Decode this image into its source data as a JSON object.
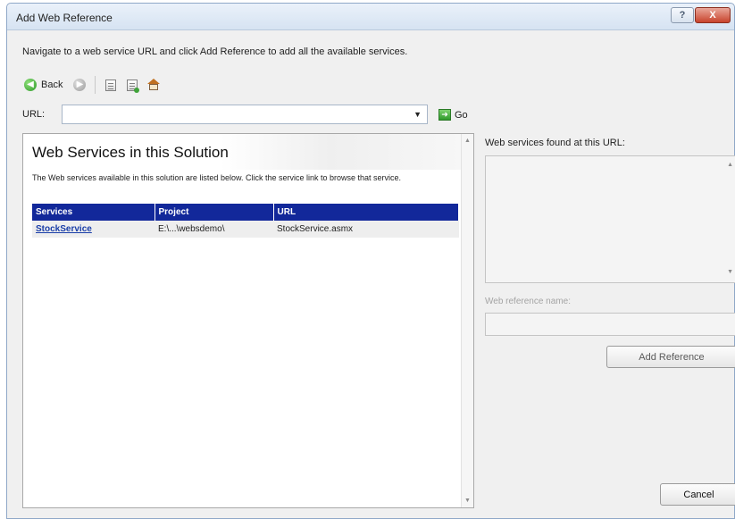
{
  "window": {
    "title": "Add Web Reference",
    "help_glyph": "?",
    "close_glyph": "X"
  },
  "instruction": "Navigate to a web service URL and click Add Reference to add all the available services.",
  "toolbar": {
    "back_label": "Back",
    "back_icon": "back-arrow-icon",
    "forward_icon": "forward-arrow-icon",
    "stop_icon": "stop-page-icon",
    "refresh_icon": "refresh-page-icon",
    "home_icon": "home-icon"
  },
  "url_bar": {
    "label": "URL:",
    "value": "",
    "dropdown_glyph": "▼",
    "go_label": "Go",
    "go_icon": "go-arrow-icon"
  },
  "browser": {
    "heading": "Web Services in this Solution",
    "description": "The Web services available in this solution are listed below. Click the service link to browse that service.",
    "table": {
      "columns": [
        "Services",
        "Project",
        "URL"
      ],
      "rows": [
        {
          "service": "StockService",
          "project": "E:\\...\\websdemo\\",
          "url": "StockService.asmx"
        }
      ]
    }
  },
  "right_panel": {
    "found_label": "Web services found at this URL:",
    "found_items": [],
    "reference_name_label": "Web reference name:",
    "reference_name_value": "",
    "add_reference_button": "Add Reference",
    "add_reference_enabled": false
  },
  "footer": {
    "cancel_button": "Cancel"
  },
  "colors": {
    "table_header_bg": "#12289a",
    "table_header_text": "#ffffff",
    "link": "#1a3ea8",
    "disabled_text": "#a4a4a4"
  }
}
